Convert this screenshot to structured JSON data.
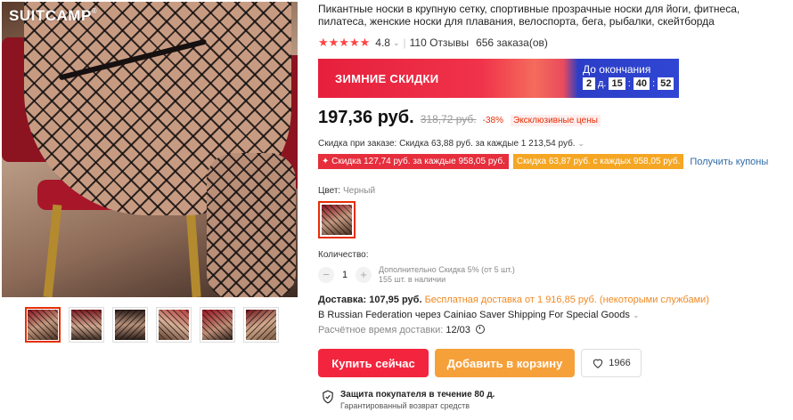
{
  "gallery": {
    "brand": "SUITCAMP",
    "brand_mark": "®",
    "thumbnails_count": 6
  },
  "product": {
    "title": "Пикантные носки в крупную сетку, спортивные прозрачные носки для йоги, фитнеса, пилатеса, женские носки для плавания, велоспорта, бега, рыбалки, скейтборда",
    "stars": "★★★★★",
    "rating": "4.8",
    "reviews": "110 Отзывы",
    "orders": "656 заказа(ов)"
  },
  "sale": {
    "label": "ЗИМНИЕ СКИДКИ",
    "countdown_label": "До окончания",
    "days": "2",
    "days_unit": "д.",
    "hours": "15",
    "minutes": "40",
    "seconds": "52"
  },
  "price": {
    "current": "197,36 руб.",
    "old": "318,72 руб.",
    "discount": "-38%",
    "exclusive": "Эксклюзивные цены"
  },
  "coupons": {
    "note": "Скидка при заказе: Скидка 63,88 руб. за каждые 1 213,54 руб.",
    "coupon1": "✦ Скидка 127,74 руб. за каждые 958,05 руб.",
    "coupon2": "Скидка 63,87 руб. с каждых 958,05 руб.",
    "get": "Получить купоны"
  },
  "color": {
    "label": "Цвет:",
    "value": "Черный"
  },
  "quantity": {
    "label": "Количество:",
    "value": "1",
    "extra_discount": "Дополнительно Скидка 5% (от 5 шт.)",
    "stock": "155 шт. в наличии"
  },
  "shipping": {
    "cost": "Доставка: 107,95 руб.",
    "free_note": "Бесплатная доставка от 1 916,85 руб. (некоторыми службами)",
    "route": "В Russian Federation через Cainiao Saver Shipping For Special Goods",
    "eta_label": "Расчётное время доставки:",
    "eta": "12/03"
  },
  "actions": {
    "buy": "Купить сейчас",
    "cart": "Добавить в корзину",
    "wishlist_count": "1966"
  },
  "protection": {
    "title": "Защита покупателя в течение 80 д.",
    "subtitle": "Гарантированный возврат средств"
  },
  "colors": {
    "accent_red": "#f3253e",
    "accent_orange": "#f6a03a",
    "link_blue": "#2f6ba8",
    "sale_blue": "#3046d3"
  }
}
